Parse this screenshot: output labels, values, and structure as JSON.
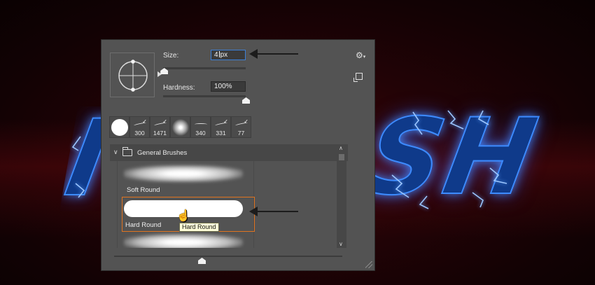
{
  "background": {
    "artwork_text_left": "I",
    "artwork_text_right": "SH"
  },
  "brush_panel": {
    "size_label": "Size:",
    "size_value": "4",
    "size_unit": "px",
    "size_level": 0.01,
    "hardness_label": "Hardness:",
    "hardness_value": "100%",
    "hardness_level": 1.0,
    "settings_icon": "gear-icon",
    "new_preset_icon": "new-preset-icon",
    "recent_tips": [
      {
        "label": ""
      },
      {
        "label": "300"
      },
      {
        "label": "1471"
      },
      {
        "label": ""
      },
      {
        "label": "340"
      },
      {
        "label": "331"
      },
      {
        "label": "77"
      }
    ],
    "group_name": "General Brushes",
    "brushes": [
      {
        "label": "Soft Round"
      },
      {
        "label": "Hard Round"
      }
    ],
    "tooltip": "Hard Round",
    "accent_color": "#e07420",
    "active_field_color": "#3c7fd6"
  }
}
